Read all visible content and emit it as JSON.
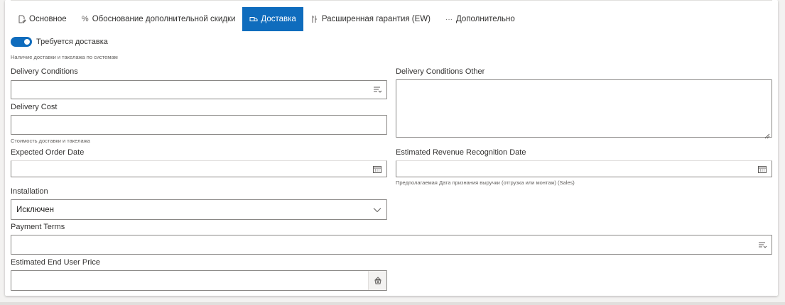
{
  "tabs": [
    {
      "label": "Основное",
      "icon": "edit-doc-icon",
      "active": false
    },
    {
      "label": "Обоснование дополнительной скидки",
      "icon": "percent-icon",
      "active": false
    },
    {
      "label": "Доставка",
      "icon": "truck-icon",
      "active": true
    },
    {
      "label": "Расширенная гарантия (EW)",
      "icon": "wrench-icon",
      "active": false
    },
    {
      "label": "Дополнительно",
      "icon": "more-icon",
      "active": false
    }
  ],
  "delivery_toggle": {
    "label": "Требуется доставка",
    "on": true,
    "hint": "Наличие доставки и такелажа по системам"
  },
  "fields": {
    "delivery_conditions": {
      "label": "Delivery Conditions",
      "value": ""
    },
    "delivery_conditions_other": {
      "label": "Delivery Conditions Other",
      "value": ""
    },
    "delivery_cost": {
      "label": "Delivery Cost",
      "value": "",
      "hint": "Стоимость доставки и такелажа"
    },
    "expected_order_date": {
      "label": "Expected Order Date",
      "value": ""
    },
    "estimated_revenue_recognition_date": {
      "label": "Estimated Revenue Recognition Date",
      "value": "",
      "hint": "Предполагаемая Дата признания выручки (отгрузка или монтаж) (Sales)"
    },
    "installation": {
      "label": "Installation",
      "value": "Исключен"
    },
    "payment_terms": {
      "label": "Payment Terms",
      "value": ""
    },
    "estimated_end_user_price": {
      "label": "Estimated End User Price",
      "value": ""
    }
  },
  "colors": {
    "accent": "#0f6cbd",
    "border": "#8a8886",
    "hint": "#605e5c"
  }
}
